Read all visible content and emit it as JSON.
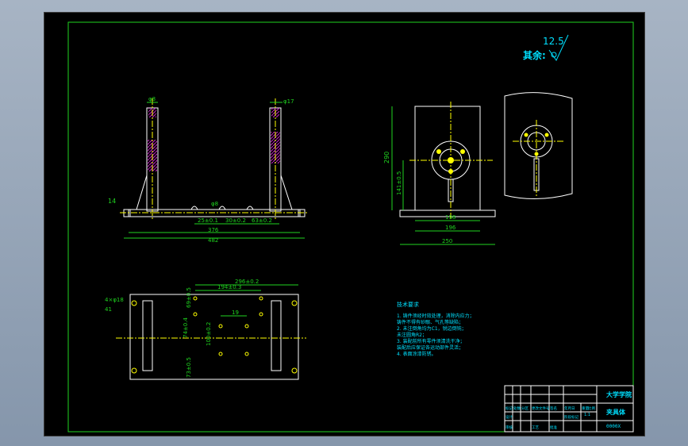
{
  "colors": {
    "background": "#000000",
    "frame": "#1fd31f",
    "outline": "#ffffff",
    "dimension": "#1fd31f",
    "hatch": "#c81fc8",
    "note": "#00e0ff",
    "center": "#ffff00"
  },
  "surface_finish": {
    "value": "12.5",
    "label": "其余:"
  },
  "front_view": {
    "dims": {
      "top_left": "φ8",
      "top_right": "φ17",
      "left_height": "14",
      "hole": "φ8",
      "d1": "25±0.1",
      "d2": "30±0.2",
      "d3": "63±0.2",
      "d4": "376",
      "d5": "482"
    }
  },
  "side_view": {
    "dims": {
      "height": "290",
      "lower": "141±0.5",
      "w1": "198",
      "w2": "196",
      "w3": "250"
    }
  },
  "plan_view": {
    "dims": {
      "d_top": "296±0.2",
      "d_mid": "194±0.3",
      "d_small": "19",
      "left_a": "4×φ18",
      "left_b": "41",
      "left_c": "74±0.4",
      "v1": "69±0.5",
      "v2": "100±0.2",
      "v3": "73±0.5"
    }
  },
  "notes": {
    "title": "技术要求",
    "lines": [
      "1. 铸件须经时效处理，消除内应力；",
      "   铸件不得有砂眼、气孔等缺陷；",
      "2. 未注倒角均为C1，锐边倒钝；",
      "   未注圆角R2；",
      "3. 装配前所有零件须清洗干净；",
      "   装配后应保证各运动部件灵活；",
      "4. 表面涂漆防锈。"
    ]
  },
  "title_block": {
    "school": "大学学院",
    "name": "夹具体",
    "drawing_no": "0000X",
    "scale": "1:1",
    "row_labels": [
      "标记",
      "处数",
      "分区",
      "更改文件号",
      "签名",
      "年月日"
    ],
    "small_labels": [
      "设计",
      "审核",
      "工艺",
      "批准",
      "阶段标记",
      "重量",
      "比例"
    ]
  }
}
